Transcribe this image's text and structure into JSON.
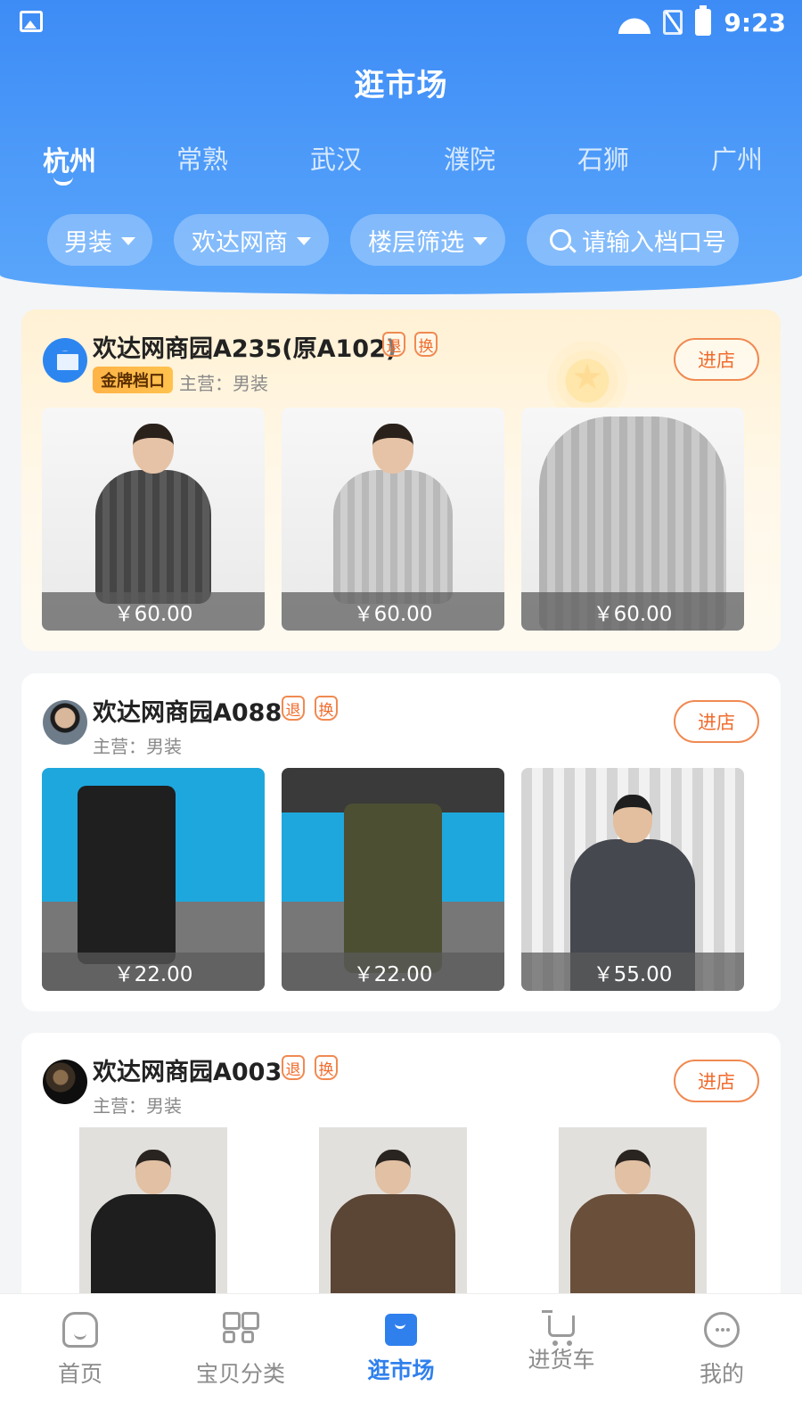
{
  "status_bar": {
    "time": "9:23"
  },
  "header": {
    "title": "逛市场"
  },
  "city_tabs": [
    "杭州",
    "常熟",
    "武汉",
    "濮院",
    "石狮",
    "广州"
  ],
  "filters": {
    "category": "男装",
    "market": "欢达网商",
    "floor": "楼层筛选",
    "search_placeholder": "请输入档口号"
  },
  "stores": [
    {
      "name": "欢达网商园A235(原A102)",
      "tags": [
        "退",
        "换"
      ],
      "badge": "金牌档口",
      "main_business": "主营：男装",
      "enter_label": "进店",
      "products": [
        {
          "price": "￥60.00"
        },
        {
          "price": "￥60.00"
        },
        {
          "price": "￥60.00"
        }
      ]
    },
    {
      "name": "欢达网商园A088",
      "tags": [
        "退",
        "换"
      ],
      "main_business": "主营：男装",
      "enter_label": "进店",
      "products": [
        {
          "price": "￥22.00"
        },
        {
          "price": "￥22.00"
        },
        {
          "price": "￥55.00"
        }
      ]
    },
    {
      "name": "欢达网商园A003",
      "tags": [
        "退",
        "换"
      ],
      "main_business": "主营：男装",
      "enter_label": "进店",
      "products": [
        {},
        {},
        {}
      ]
    }
  ],
  "bottom_nav": [
    {
      "label": "首页",
      "icon": "home-icon"
    },
    {
      "label": "宝贝分类",
      "icon": "category-grid-icon"
    },
    {
      "label": "逛市场",
      "icon": "market-bag-icon",
      "active": true
    },
    {
      "label": "进货车",
      "icon": "cart-icon"
    },
    {
      "label": "我的",
      "icon": "profile-icon"
    }
  ],
  "colors": {
    "primary": "#3d8cf6",
    "accent_orange": "#f06b2c",
    "gold": "#ffb347"
  }
}
